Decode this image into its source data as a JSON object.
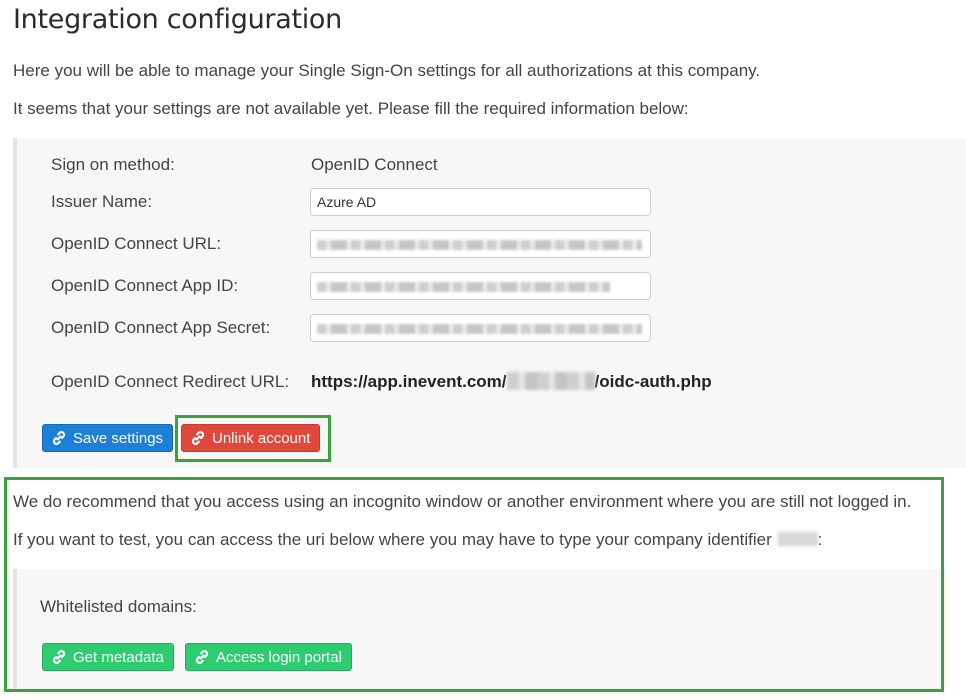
{
  "page": {
    "title": "Integration configuration",
    "intro_1": "Here you will be able to manage your Single Sign-On settings for all authorizations at this company.",
    "intro_2": "It seems that your settings are not available yet. Please fill the required information below:"
  },
  "settings": {
    "sign_on_method_label": "Sign on method:",
    "sign_on_method_value": "OpenID Connect",
    "issuer_name_label": "Issuer Name:",
    "issuer_name_value": "Azure AD",
    "connect_url_label": "OpenID Connect URL:",
    "app_id_label": "OpenID Connect App ID:",
    "app_secret_label": "OpenID Connect App Secret:",
    "redirect_url_label": "OpenID Connect Redirect URL:",
    "redirect_url_prefix": "https://app.inevent.com/",
    "redirect_url_suffix": "/oidc-auth.php"
  },
  "actions": {
    "save_label": "Save settings",
    "unlink_label": "Unlink account"
  },
  "testing": {
    "recommendation": "We do recommend that you access using an incognito window or another environment where you are still not logged in.",
    "test_note_prefix": "If you want to test, you can access the uri below where you may have to type your company identifier",
    "test_note_suffix": ":",
    "whitelisted_label": "Whitelisted domains:",
    "metadata_label": "Get metadata",
    "portal_label": "Access login portal"
  },
  "colors": {
    "primary": "#1e7fd8",
    "danger": "#e0483b",
    "success": "#2ecc71",
    "highlight": "#3aa33a"
  },
  "icons": {
    "button_icon": "link-icon"
  }
}
